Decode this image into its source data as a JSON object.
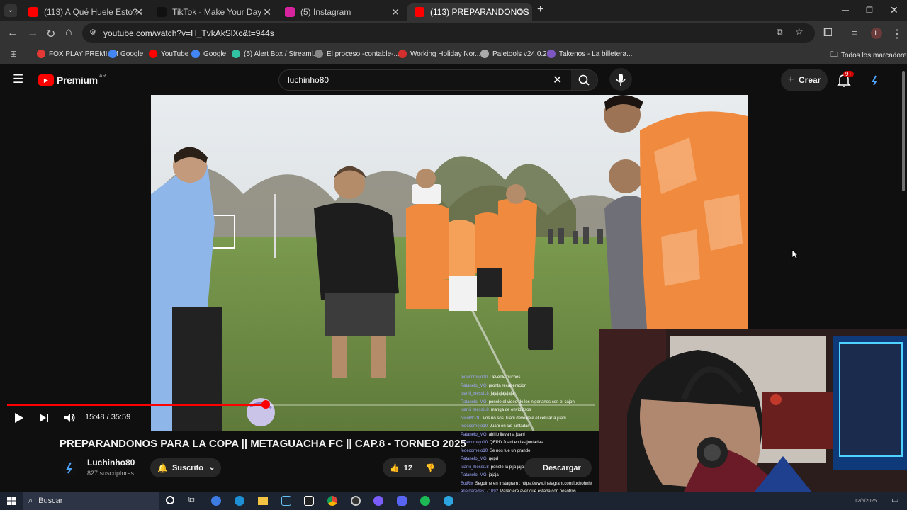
{
  "browser": {
    "tabs": [
      {
        "title": "(113) A Qué Huele Esto? - YouTub",
        "favicon_color": "#ff0000",
        "active": false
      },
      {
        "title": "TikTok - Make Your Day",
        "favicon_color": "#111111",
        "active": false
      },
      {
        "title": "(5) Instagram",
        "favicon_color": "#d6249f",
        "active": false
      },
      {
        "title": "(113) PREPARANDONOS PARA LA",
        "favicon_color": "#ff0000",
        "active": true
      }
    ],
    "new_tab": "+",
    "url": "youtube.com/watch?v=H_TvkAkSlXc&t=944s",
    "bookmarks": [
      {
        "label": "FOX PLAY PREMIUM",
        "color": "#e53935"
      },
      {
        "label": "Google",
        "color": "#4285f4"
      },
      {
        "label": "YouTube",
        "color": "#ff0000"
      },
      {
        "label": "Google",
        "color": "#4285f4"
      },
      {
        "label": "(5) Alert Box / Streaml...",
        "color": "#31c3a2"
      },
      {
        "label": "El proceso -contable-...",
        "color": "#888888"
      },
      {
        "label": "Working Holiday Nor...",
        "color": "#d32f2f"
      },
      {
        "label": "Paletools v24.0.29",
        "color": "#aaaaaa"
      },
      {
        "label": "Takenos - La billetera...",
        "color": "#7e57c2"
      }
    ],
    "all_bookmarks": "Todos los marcadores"
  },
  "youtube": {
    "logo_text": "Premium",
    "country": "AR",
    "search_value": "luchinho80",
    "create_label": "Crear",
    "notif_count": "9+",
    "player": {
      "time": "15:48 / 35:59",
      "progress": 0.44
    },
    "video_title": "PREPARANDONOS PARA LA COPA || METAGUACHA FC || CAP.8 - TORNEO 2025",
    "channel_name": "Luchinho80",
    "subscribers": "827 suscriptores",
    "subscribe_label": "Suscrito",
    "likes": "12",
    "download_label": "Descargar"
  },
  "chat": [
    {
      "user": "fedecornejo10",
      "msg": "Llevenle puchos"
    },
    {
      "user": "Patanelo_MG",
      "msg": "pronta recuperacion"
    },
    {
      "user": "juanii_messi18",
      "msg": "jajajajajajaja"
    },
    {
      "user": "Patanelo_MG",
      "msg": "ponele el video de los nigerianos con el cajon"
    },
    {
      "user": "juanii_messi18",
      "msg": "manga de envidiosos"
    },
    {
      "user": "NicoMG10",
      "msg": "Vos no sos Juani devolvele el celular a juani"
    },
    {
      "user": "fedecornejo10",
      "msg": "Juani en las juntadas"
    },
    {
      "user": "Patanelo_MG",
      "msg": "ahi lo llevan a juani"
    },
    {
      "user": "fedecornejo10",
      "msg": "QEPD Juani en las juntadas"
    },
    {
      "user": "fedecornejo10",
      "msg": "Se nos fue un grande"
    },
    {
      "user": "Patanelo_MG",
      "msg": "qepd"
    },
    {
      "user": "juanii_messi18",
      "msg": "ponele la pija jajajaja"
    },
    {
      "user": "Patanelo_MG",
      "msg": "jajaja"
    },
    {
      "user": "BotRix",
      "msg": "Seguime en Instagram : https://www.instagram.com/luchohnh/"
    },
    {
      "user": "arielparedes171092",
      "msg": "Parecíera ayer que estaba con nosotros"
    }
  ],
  "taskbar": {
    "search_placeholder": "Buscar",
    "date": "12/6/2025"
  }
}
